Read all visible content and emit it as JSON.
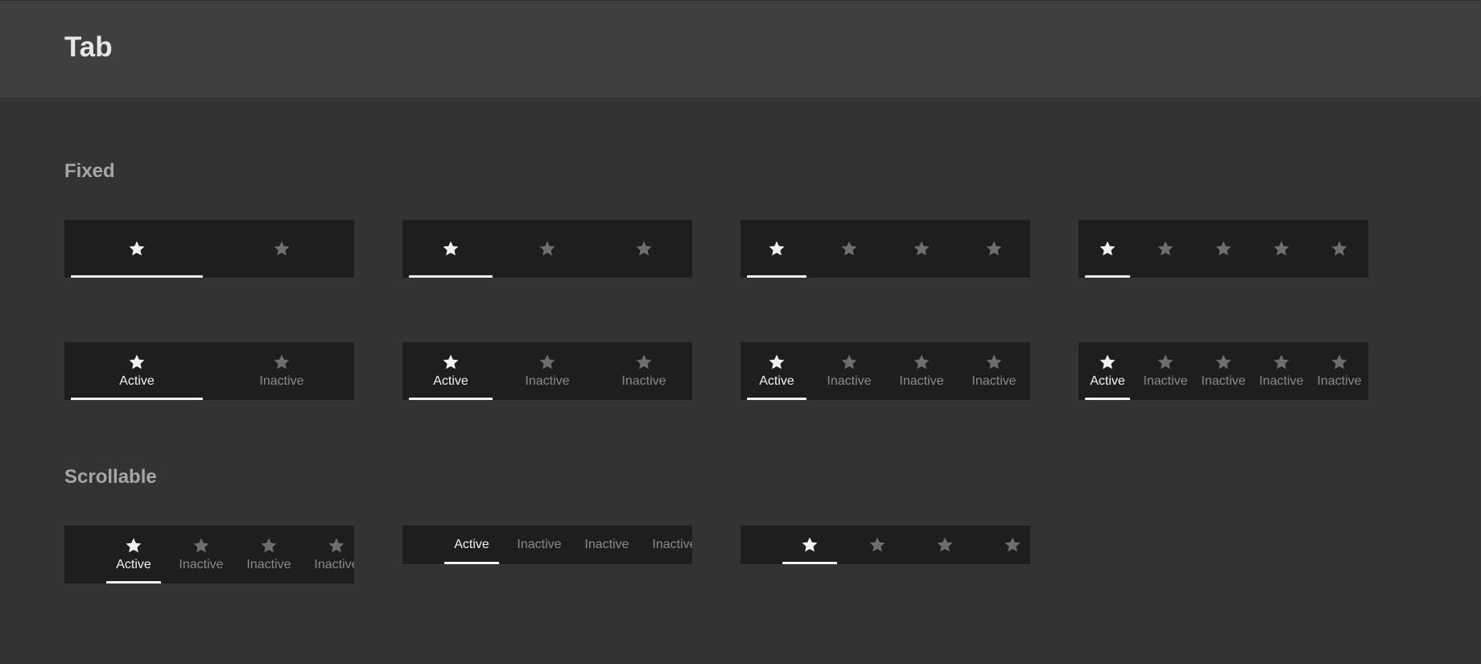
{
  "page": {
    "title": "Tab"
  },
  "sections": {
    "fixed": "Fixed",
    "scrollable": "Scrollable"
  },
  "labels": {
    "active": "Active",
    "inactive": "Inactive"
  },
  "colors": {
    "background": "#333333",
    "header": "#3f3f3f",
    "tab_bar": "#1e1e1e",
    "active": "#f2f2f2",
    "inactive": "#6e6e6e"
  },
  "icon": "star-icon",
  "tab_bars": [
    {
      "group": "fixed",
      "tab_count": 2,
      "show_icon": true,
      "show_label": false,
      "active_index": 0
    },
    {
      "group": "fixed",
      "tab_count": 3,
      "show_icon": true,
      "show_label": false,
      "active_index": 0
    },
    {
      "group": "fixed",
      "tab_count": 4,
      "show_icon": true,
      "show_label": false,
      "active_index": 0
    },
    {
      "group": "fixed",
      "tab_count": 5,
      "show_icon": true,
      "show_label": false,
      "active_index": 0
    },
    {
      "group": "fixed",
      "tab_count": 2,
      "show_icon": true,
      "show_label": true,
      "active_index": 0
    },
    {
      "group": "fixed",
      "tab_count": 3,
      "show_icon": true,
      "show_label": true,
      "active_index": 0
    },
    {
      "group": "fixed",
      "tab_count": 4,
      "show_icon": true,
      "show_label": true,
      "active_index": 0
    },
    {
      "group": "fixed",
      "tab_count": 5,
      "show_icon": true,
      "show_label": true,
      "active_index": 0
    },
    {
      "group": "scrollable",
      "tab_count": 4,
      "show_icon": true,
      "show_label": true,
      "active_index": 0
    },
    {
      "group": "scrollable",
      "tab_count": 4,
      "show_icon": false,
      "show_label": true,
      "active_index": 0
    },
    {
      "group": "scrollable",
      "tab_count": 4,
      "show_icon": true,
      "show_label": false,
      "active_index": 0
    }
  ]
}
